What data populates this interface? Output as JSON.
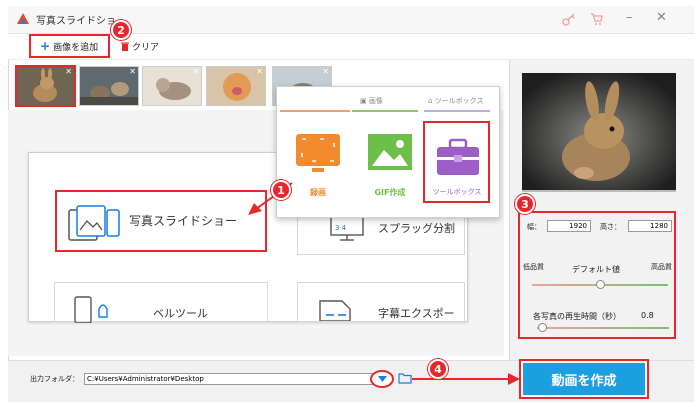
{
  "window": {
    "title": "写真スライドショ"
  },
  "toolbar": {
    "add_image_label": "画像を追加",
    "clear_label": "クリア"
  },
  "badges": [
    "1",
    "2",
    "3",
    "4"
  ],
  "thumbnails": [
    {
      "name": "rabbit",
      "selected": true
    },
    {
      "name": "cats-outdoor",
      "selected": false
    },
    {
      "name": "cat-lying",
      "selected": false
    },
    {
      "name": "cat-yawning",
      "selected": false
    },
    {
      "name": "dog",
      "selected": false
    }
  ],
  "popup": {
    "tab_image": "画像",
    "tab_toolbox": "ツールボックス",
    "items": [
      {
        "label": "録画",
        "color": "#f28a2e"
      },
      {
        "label": "GIF作成",
        "color": "#6cc04a"
      },
      {
        "label": "ツールボックス",
        "color": "#9b5fc7"
      }
    ]
  },
  "menu": {
    "slideshow_label": "写真スライドショー",
    "top_right_label": "スプラッグ分割",
    "bell_label": "ベルツール",
    "subtitle_label": "字幕エクスポー"
  },
  "settings": {
    "width_label": "幅：",
    "width_value": "1920",
    "height_label": "高さ：",
    "height_value": "1280",
    "low_label": "低品質",
    "default_label": "デフォルト値",
    "high_label": "高品質",
    "duration_label": "各写真の再生時間（秒）",
    "duration_value": "0.8",
    "quality_level": 0.5,
    "duration_level": 0.04
  },
  "bottom": {
    "output_label": "出力フォルダ：",
    "output_path": "C:¥Users¥Administrator¥Desktop",
    "create_button": "動画を作成"
  },
  "colors": {
    "accent": "#e8262b",
    "primary_button": "#1aa0e0",
    "folder_blue": "#1a7de0"
  }
}
